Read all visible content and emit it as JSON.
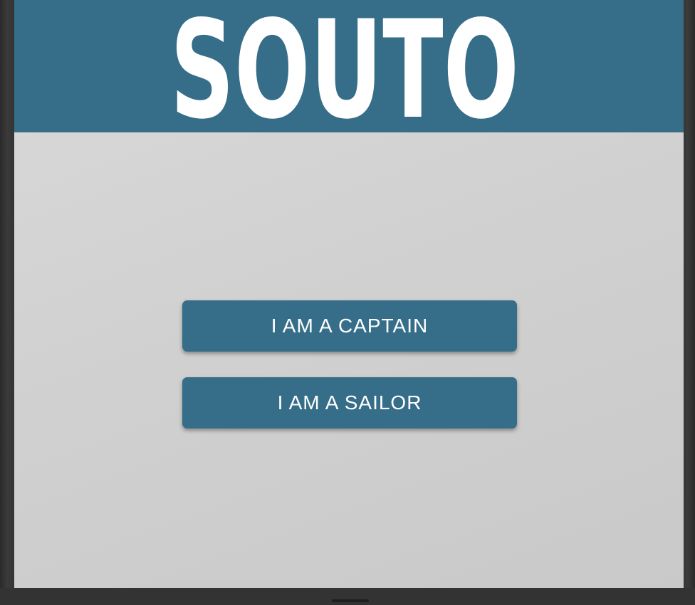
{
  "header": {
    "logo_text": "SOUTO",
    "background_color": "#366e89"
  },
  "buttons": {
    "captain_label": "I AM A CAPTAIN",
    "sailor_label": "I AM A SAILOR",
    "color": "#366e89",
    "text_color": "#ffffff"
  }
}
